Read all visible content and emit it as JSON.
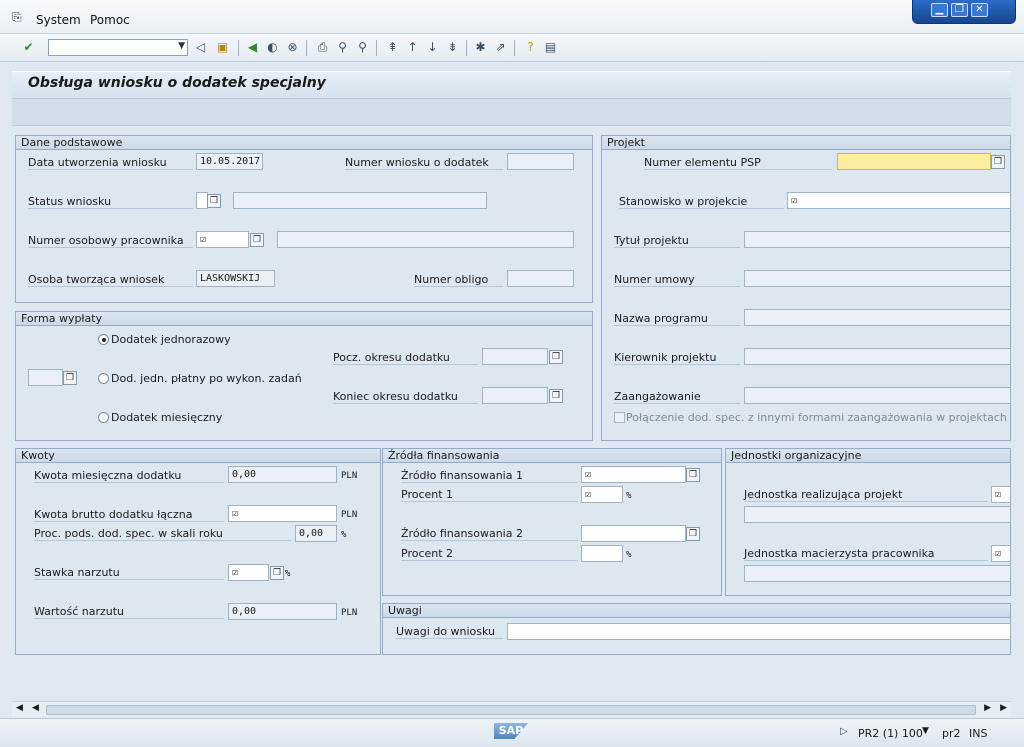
{
  "menu": {
    "system": "System",
    "help": "Pomoc"
  },
  "toolbar": {
    "command_value": ""
  },
  "screen": {
    "title": "Obsługa wniosku o dodatek specjalny"
  },
  "dane": {
    "title": "Dane podstawowe",
    "data_label": "Data utworzenia wniosku",
    "data_value": "10.05.2017",
    "numer_wniosku_label": "Numer wniosku o dodatek",
    "numer_wniosku_value": "",
    "status_label": "Status wniosku",
    "status_value": "",
    "status_text": "",
    "pracownik_label": "Numer osobowy pracownika",
    "pracownik_value": "☑",
    "pracownik_text": "",
    "osoba_label": "Osoba tworząca wniosek",
    "osoba_value": "LASKOWSKIJ",
    "obligo_label": "Numer obligo",
    "obligo_value": ""
  },
  "forma": {
    "title": "Forma wypłaty",
    "opt1": "Dodatek jednorazowy",
    "opt2": "Dod. jedn. płatny po wykon. zadań",
    "opt3": "Dodatek miesięczny",
    "selected": "Dodatek jednorazowy",
    "pocz_label": "Pocz. okresu dodatku",
    "koniec_label": "Koniec okresu dodatku"
  },
  "projekt": {
    "title": "Projekt",
    "psp_label": "Numer elementu PSP",
    "psp_value": "",
    "stanowisko_label": "Stanowisko w projekcie",
    "stanowisko_value": "☑",
    "tytul_label": "Tytuł projektu",
    "umowa_label": "Numer umowy",
    "program_label": "Nazwa programu",
    "kierownik_label": "Kierownik projektu",
    "zaang_label": "Zaangażowanie",
    "polaczenie_label": "Połączenie dod. spec. z innymi formami zaangażowania w projektach"
  },
  "kwoty": {
    "title": "Kwoty",
    "miesieczna_label": "Kwota miesięczna dodatku",
    "miesieczna_value": "0,00",
    "brutto_label": "Kwota brutto dodatku łączna",
    "brutto_value": "☑",
    "proc_label": "Proc. pods. dod. spec. w skali roku",
    "proc_value": "0,00",
    "stawka_label": "Stawka narzutu",
    "stawka_value": "☑",
    "wartosc_label": "Wartość narzutu",
    "wartosc_value": "0,00",
    "currency": "PLN",
    "percent": "%"
  },
  "zrodla": {
    "title": "Źródła finansowania",
    "z1_label": "Źródło finansowania 1",
    "z1_value": "☑",
    "p1_label": "Procent 1",
    "p1_value": "☑",
    "z2_label": "Źródło finansowania 2",
    "z2_value": "",
    "p2_label": "Procent 2",
    "p2_value": "",
    "percent": "%"
  },
  "jednostki": {
    "title": "Jednostki organizacyjne",
    "realizujaca_label": "Jednostka realizująca projekt",
    "macierzysta_label": "Jednostka macierzysta pracownika"
  },
  "uwagi": {
    "title": "Uwagi",
    "label": "Uwagi do wniosku",
    "value": ""
  },
  "status": {
    "system": "PR2 (1) 100",
    "server": "pr2",
    "mode": "INS",
    "logo": "SAP"
  }
}
